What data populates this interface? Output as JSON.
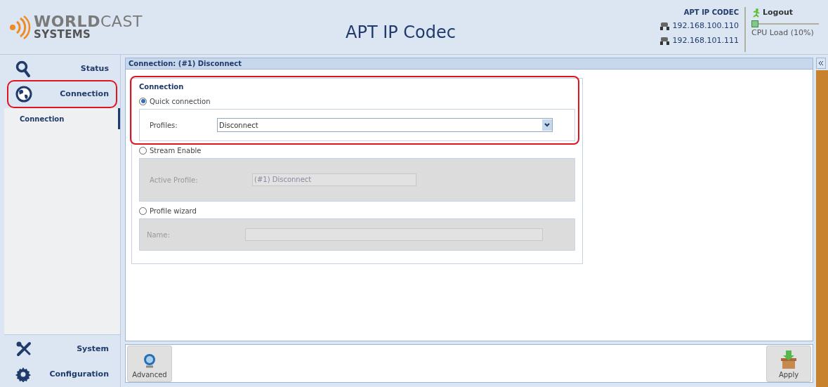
{
  "header": {
    "logo": "**WORLD**CAST",
    "logo_sub": "SYSTEMS",
    "title": "APT IP Codec",
    "device_name": "APT IP CODEC",
    "addresses": [
      "192.168.100.110",
      "192.168.101.111"
    ],
    "logout": "Logout",
    "cpu": {
      "label": "CPU Load (10%)",
      "level": 0.1
    }
  },
  "sidebar": {
    "items": [
      {
        "label": "Status",
        "kind": "search",
        "selected": false
      },
      {
        "label": "Connection",
        "kind": "globe",
        "selected": true,
        "children": [
          {
            "label": "Connection",
            "selected": true
          }
        ]
      }
    ],
    "bottom_items": [
      {
        "label": "System",
        "kind": "tools",
        "selected": false
      },
      {
        "label": "Configuration",
        "kind": "gear",
        "selected": false
      }
    ]
  },
  "panel": {
    "title": "Connection: (#1) Disconnect",
    "fieldset_title": "Connection",
    "options": [
      {
        "kind": "select",
        "label": "Quick connection",
        "selected": true,
        "field_label": "Profiles:",
        "value": "Disconnect"
      },
      {
        "kind": "text",
        "label": "Stream Enable",
        "selected": false,
        "field_label": "Active Profile:",
        "value": "(#1) Disconnect"
      },
      {
        "kind": "input",
        "label": "Profile wizard",
        "selected": false,
        "field_label": "Name:"
      }
    ]
  },
  "toolbar": {
    "advanced": "Advanced",
    "apply": "Apply"
  }
}
